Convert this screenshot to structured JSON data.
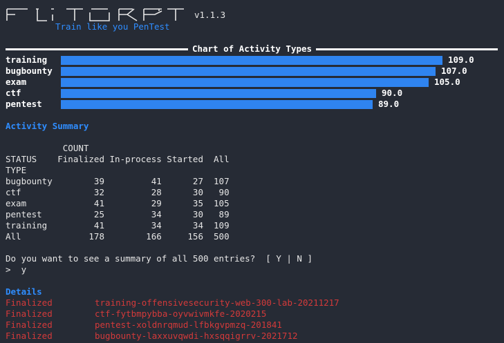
{
  "banner": {
    "version": "v1.1.3",
    "tagline": "Train like you PenTest"
  },
  "chart_data": {
    "type": "bar",
    "title": "Chart of Activity Types",
    "orientation": "horizontal",
    "categories": [
      "training",
      "bugbounty",
      "exam",
      "ctf",
      "pentest"
    ],
    "values": [
      109.0,
      107.0,
      105.0,
      90.0,
      89.0
    ],
    "value_labels": [
      "109.0",
      "107.0",
      "105.0",
      "90.0",
      "89.0"
    ],
    "xlim": [
      0,
      109
    ],
    "color": "#2f84f0"
  },
  "summary": {
    "title": "Activity Summary",
    "header_line1": "           COUNT",
    "header_line2": "STATUS    Finalized In-process Started  All",
    "header_line3": "TYPE",
    "rows": [
      "bugbounty        39         41      27  107",
      "ctf              32         28      30   90",
      "exam             41         29      35  105",
      "pentest          25         34      30   89",
      "training         41         34      34  109",
      "All             178        166     156  500"
    ]
  },
  "prompt": {
    "question": "Do you want to see a summary of all 500 entries?  [ Y | N ]",
    "answer": ">  y"
  },
  "details": {
    "title": "Details",
    "entries": [
      {
        "status": "Finalized",
        "name": "training-offensivesecurity-web-300-lab-20211217"
      },
      {
        "status": "Finalized",
        "name": "ctf-fytbmpybba-oyvwivmkfe-2020215"
      },
      {
        "status": "Finalized",
        "name": "pentest-xoldnrqmud-lfbkgvpmzq-201841"
      },
      {
        "status": "Finalized",
        "name": "bugbounty-laxxuvqwdi-hxsqqigrrv-2021712"
      }
    ]
  },
  "colors": {
    "background": "#262b35",
    "accent": "#2f8dff",
    "bar": "#2f84f0",
    "detail_text": "#d43a3a"
  }
}
